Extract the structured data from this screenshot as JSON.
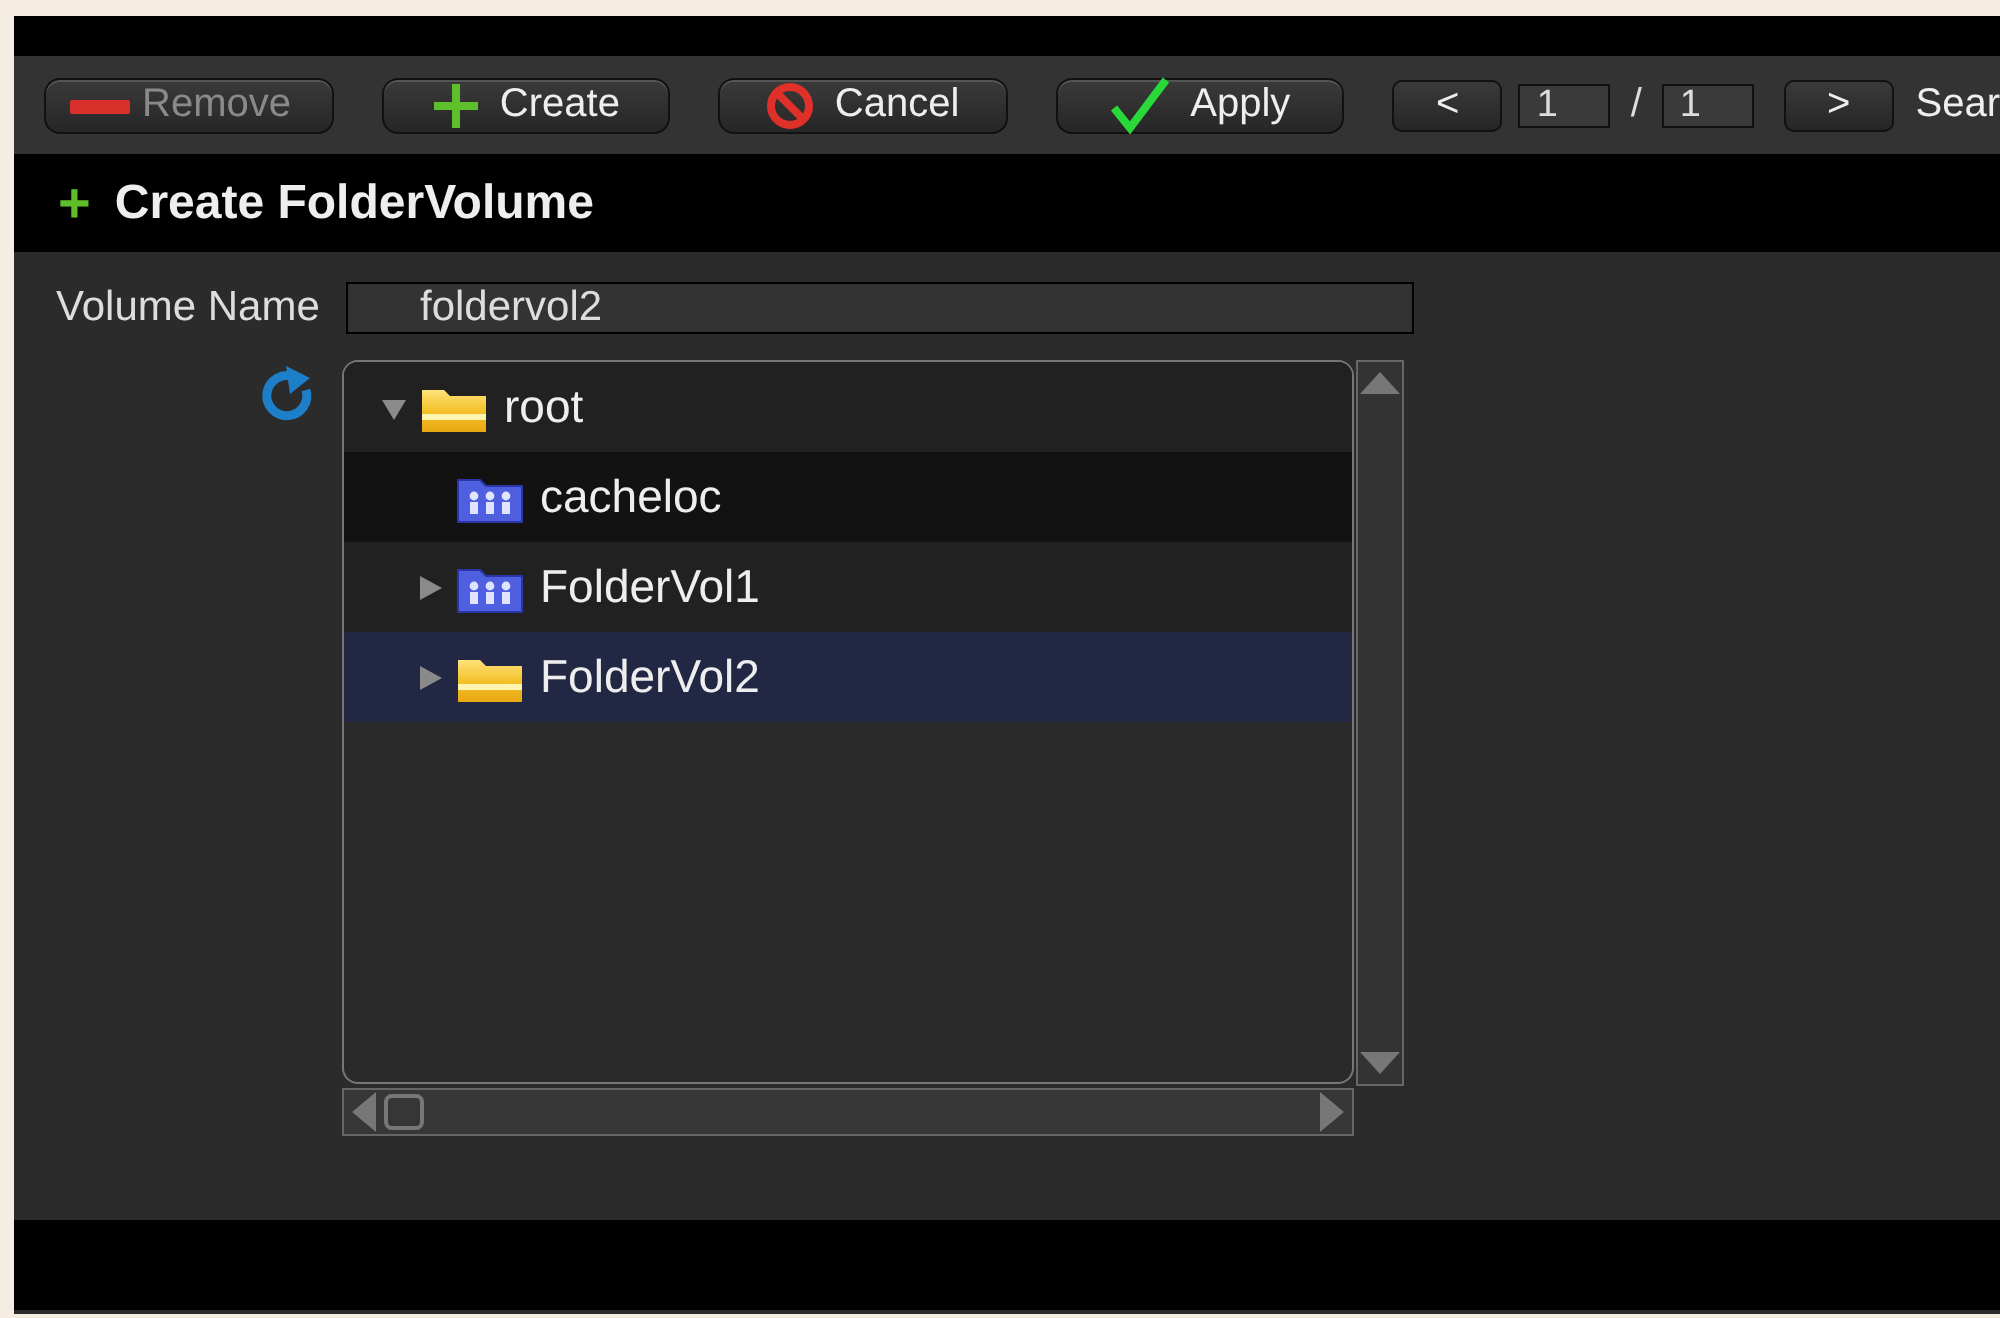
{
  "toolbar": {
    "buttons": [
      {
        "label": "Remove",
        "kind": "remove",
        "disabled": true
      },
      {
        "label": "Create",
        "kind": "create",
        "disabled": false
      },
      {
        "label": "Cancel",
        "kind": "cancel",
        "disabled": false
      },
      {
        "label": "Apply",
        "kind": "apply",
        "disabled": false
      }
    ],
    "pager": {
      "prev": "<",
      "page": "1",
      "separator": "/",
      "total": "1",
      "next": ">"
    },
    "search_label": "Sear"
  },
  "header": {
    "icon": "+",
    "title": "Create FolderVolume"
  },
  "form": {
    "label": "Volume Name",
    "value": "foldervol2"
  },
  "tree": [
    {
      "label": "root",
      "kind": "folder",
      "expanded": true,
      "selected": false,
      "hovered": false,
      "children": [
        {
          "label": "cacheloc",
          "kind": "shared",
          "selected": false,
          "hovered": true
        },
        {
          "label": "FolderVol1",
          "kind": "shared",
          "expanded": false,
          "selected": false,
          "hovered": false
        },
        {
          "label": "FolderVol2",
          "kind": "folder",
          "expanded": false,
          "selected": true,
          "hovered": false
        }
      ]
    }
  ]
}
